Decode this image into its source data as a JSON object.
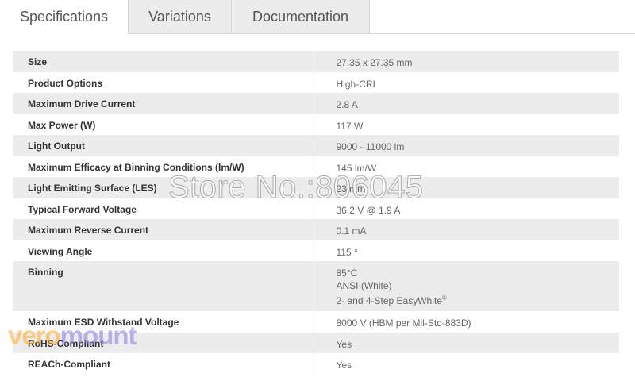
{
  "tabs": [
    {
      "label": "Specifications",
      "active": true
    },
    {
      "label": "Variations",
      "active": false
    },
    {
      "label": "Documentation",
      "active": false
    }
  ],
  "specs": [
    {
      "label": "Size",
      "value": "27.35 x 27.35 mm"
    },
    {
      "label": "Product Options",
      "value": "High-CRI"
    },
    {
      "label": "Maximum Drive Current",
      "value": "2.8 A"
    },
    {
      "label": "Max Power (W)",
      "value": "117 W"
    },
    {
      "label": "Light Output",
      "value": "9000 - 11000 lm"
    },
    {
      "label": "Maximum Efficacy at Binning Conditions (lm/W)",
      "value": "145 lm/W"
    },
    {
      "label": "Light Emitting Surface (LES)",
      "value": "23 mm"
    },
    {
      "label": "Typical Forward Voltage",
      "value": "36.2 V @ 1.9 A"
    },
    {
      "label": "Maximum Reverse Current",
      "value": "0.1 mA"
    },
    {
      "label": "Viewing Angle",
      "value": "115 °"
    },
    {
      "label": "Binning",
      "lines": [
        "85°C",
        "ANSI (White)",
        "2- and 4-Step EasyWhite"
      ],
      "sup": "®"
    },
    {
      "label": "Maximum ESD Withstand Voltage",
      "value": "8000 V (HBM per Mil-Std-883D)"
    },
    {
      "label": "RoHS-Compliant",
      "value": "Yes"
    },
    {
      "label": "REACh-Compliant",
      "value": "Yes"
    }
  ],
  "watermark": "Store No.:806045",
  "logo": {
    "part1": "vero",
    "part2": "mount"
  }
}
